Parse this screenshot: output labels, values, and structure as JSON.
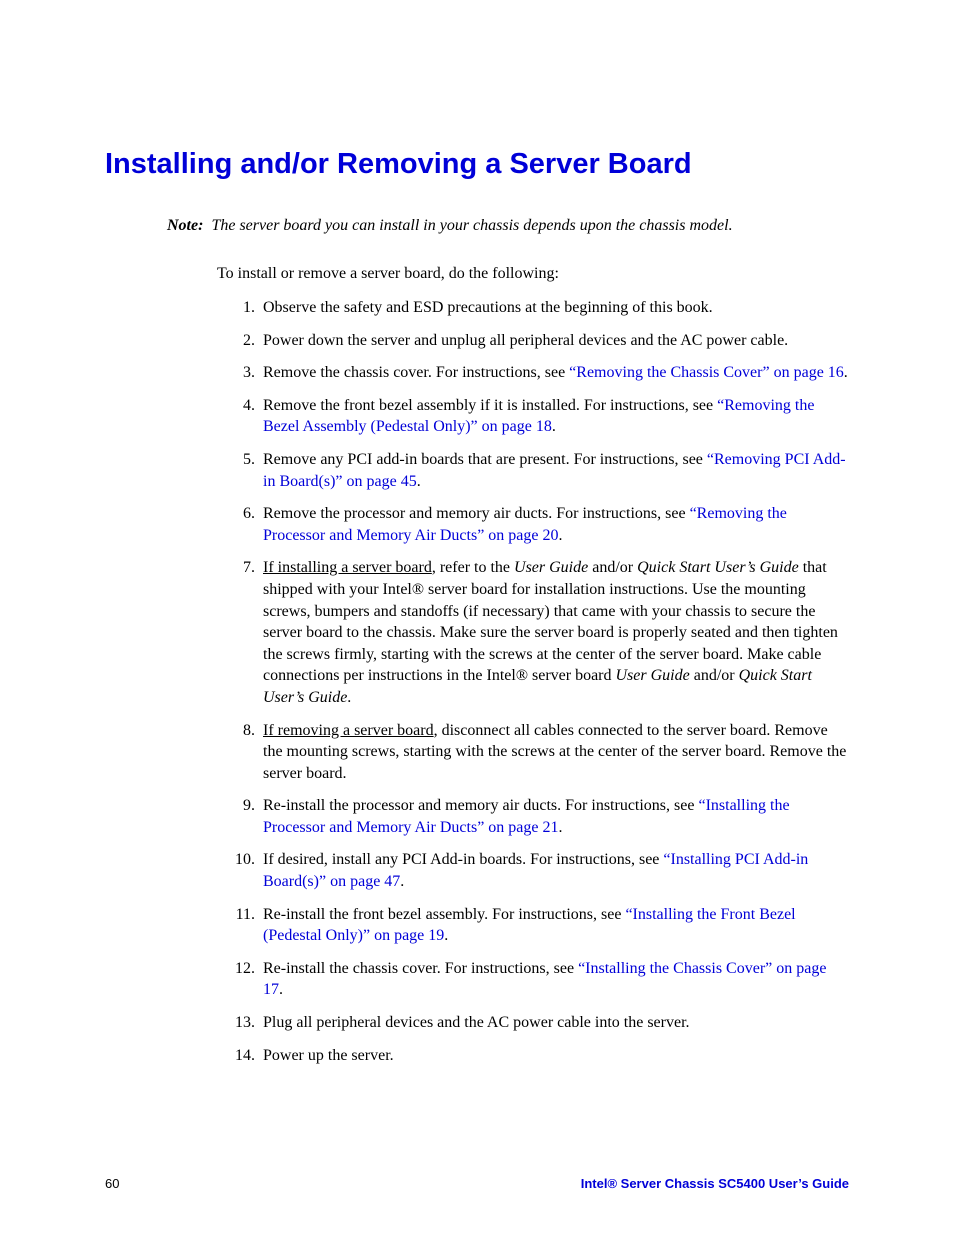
{
  "heading": "Installing and/or Removing a Server Board",
  "note": {
    "label": "Note:",
    "text": "The server board you can install in your chassis depends upon the chassis model."
  },
  "intro": "To install or remove a server board, do the following:",
  "steps": {
    "s1": "Observe the safety and ESD precautions at the beginning of this book.",
    "s2": "Power down the server and unplug all peripheral devices and the AC power cable.",
    "s3a": "Remove the chassis cover. For instructions, see ",
    "s3link": "“Removing the Chassis Cover” on page 16",
    "s3b": ".",
    "s4a": "Remove the front bezel assembly if it is installed. For instructions, see ",
    "s4link": "“Removing the Bezel Assembly (Pedestal Only)” on page 18",
    "s4b": ".",
    "s5a": "Remove any PCI add-in boards that are present. For instructions, see ",
    "s5link": "“Removing PCI Add-in Board(s)” on page 45",
    "s5b": ".",
    "s6a": "Remove the processor and memory air ducts. For instructions, see ",
    "s6link": "“Removing the Processor and Memory Air Ducts” on page 20",
    "s6b": ".",
    "s7u": "If installing a server board",
    "s7a": ", refer to the ",
    "s7i1": "User Guide",
    "s7b": " and/or ",
    "s7i2": "Quick Start User’s Guide",
    "s7c": " that shipped with your Intel® server board for installation instructions. Use the mounting screws, bumpers and standoffs (if necessary) that came with your chassis to secure the server board to the chassis. Make sure the server board is properly seated and then tighten the screws firmly, starting with the screws at the center of the server board. Make cable connections per instructions in the Intel® server board ",
    "s7i3": "User Guide",
    "s7d": " and/or ",
    "s7i4": "Quick Start User’s Guide",
    "s7e": ".",
    "s8u": "If removing a server board",
    "s8a": ", disconnect all cables connected to the server board. Remove the mounting screws, starting with the screws at the center of the server board. Remove the server board.",
    "s9a": "Re-install the processor and memory air ducts. For instructions, see ",
    "s9link": "“Installing the Processor and Memory Air Ducts” on page 21",
    "s9b": ".",
    "s10a": "If desired, install any PCI Add-in boards. For instructions, see ",
    "s10link": "“Installing PCI Add-in Board(s)” on page 47",
    "s10b": ".",
    "s11a": "Re-install the front bezel assembly. For instructions, see ",
    "s11link": "“Installing the Front Bezel (Pedestal Only)” on page 19",
    "s11b": ".",
    "s12a": "Re-install the chassis cover. For instructions, see ",
    "s12link": "“Installing the Chassis Cover” on page 17",
    "s12b": ".",
    "s13": "Plug all peripheral devices and the AC power cable into the server.",
    "s14": "Power up the server."
  },
  "footer": {
    "page": "60",
    "title": "Intel® Server Chassis SC5400 User’s Guide"
  }
}
